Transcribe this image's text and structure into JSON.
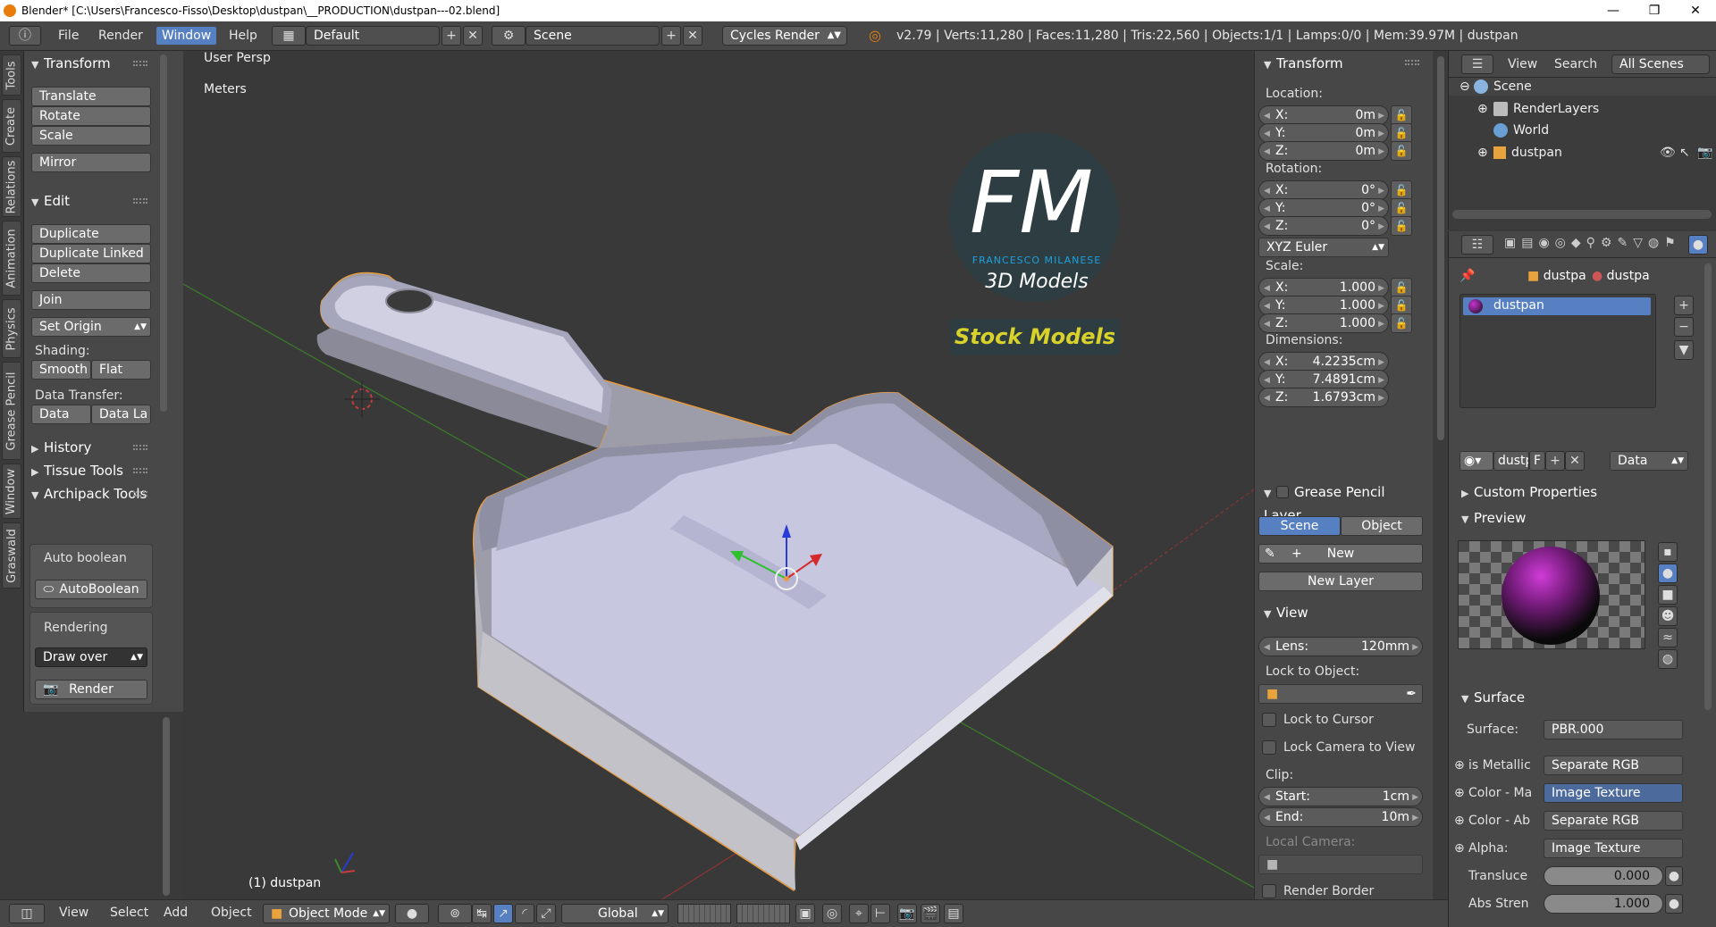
{
  "window": {
    "title": "Blender* [C:\\Users\\Francesco-Fisso\\Desktop\\dustpan\\__PRODUCTION\\dustpan---02.blend]",
    "minimize": "—",
    "maximize": "❐",
    "close": "✕"
  },
  "topbar": {
    "menus": [
      "File",
      "Render",
      "Window",
      "Help"
    ],
    "active_menu": "Window",
    "screen_layout": "Default",
    "scene": "Scene",
    "engine": "Cycles Render",
    "stats": "v2.79 | Verts:11,280 | Faces:11,280 | Tris:22,560 | Objects:1/1 | Lamps:0/0 | Mem:39.97M | dustpan"
  },
  "tool_tabs": [
    "Tools",
    "Create",
    "Relations",
    "Animation",
    "Physics",
    "Grease Pencil",
    "Window",
    "Graswald"
  ],
  "toolshelf": {
    "transform": {
      "title": "Transform",
      "buttons": [
        "Translate",
        "Rotate",
        "Scale",
        "Mirror"
      ]
    },
    "edit": {
      "title": "Edit",
      "buttons": [
        "Duplicate",
        "Duplicate Linked",
        "Delete",
        "Join"
      ],
      "set_origin": "Set Origin",
      "shading_label": "Shading:",
      "smooth": "Smooth",
      "flat": "Flat",
      "data_transfer_label": "Data Transfer:",
      "data": "Data",
      "data_la": "Data La"
    },
    "history": "History",
    "tissue": "Tissue Tools",
    "archipack": "Archipack Tools",
    "auto_boolean_label": "Auto boolean",
    "auto_boolean_btn": "AutoBoolean",
    "rendering_label": "Rendering",
    "draw_over": "Draw over",
    "render_btn": "Render"
  },
  "viewport": {
    "view_name": "User Persp",
    "units": "Meters",
    "object_label": "(1) dustpan",
    "watermark": {
      "letters": "FM",
      "name": "FRANCESCO MILANESE",
      "sub": "3D Models",
      "banner": "Stock Models"
    }
  },
  "npanel": {
    "transform_title": "Transform",
    "location_label": "Location:",
    "location": [
      {
        "k": "X:",
        "v": "0m"
      },
      {
        "k": "Y:",
        "v": "0m"
      },
      {
        "k": "Z:",
        "v": "0m"
      }
    ],
    "rotation_label": "Rotation:",
    "rotation": [
      {
        "k": "X:",
        "v": "0°"
      },
      {
        "k": "Y:",
        "v": "0°"
      },
      {
        "k": "Z:",
        "v": "0°"
      }
    ],
    "rotation_mode": "XYZ Euler",
    "scale_label": "Scale:",
    "scale": [
      {
        "k": "X:",
        "v": "1.000"
      },
      {
        "k": "Y:",
        "v": "1.000"
      },
      {
        "k": "Z:",
        "v": "1.000"
      }
    ],
    "dimensions_label": "Dimensions:",
    "dimensions": [
      {
        "k": "X:",
        "v": "4.2235cm"
      },
      {
        "k": "Y:",
        "v": "7.4891cm"
      },
      {
        "k": "Z:",
        "v": "1.6793cm"
      }
    ],
    "gp_title": "Grease Pencil Layer",
    "gp_scene": "Scene",
    "gp_object": "Object",
    "gp_new": "New",
    "gp_new_layer": "New Layer",
    "view_title": "View",
    "lens_k": "Lens:",
    "lens_v": "120mm",
    "lock_to_object": "Lock to Object:",
    "lock_to_cursor": "Lock to Cursor",
    "lock_camera": "Lock Camera to View",
    "clip_label": "Clip:",
    "clip_start_k": "Start:",
    "clip_start_v": "1cm",
    "clip_end_k": "End:",
    "clip_end_v": "10m",
    "local_camera": "Local Camera:",
    "render_border": "Render Border"
  },
  "outliner": {
    "view": "View",
    "search": "Search",
    "all_scenes": "All Scenes",
    "items": [
      "Scene",
      "RenderLayers",
      "World",
      "dustpan"
    ]
  },
  "properties": {
    "breadcrumb": [
      "dustpa",
      "dustpa"
    ],
    "material_slot": "dustpan",
    "mat_name": "dustp",
    "mat_f": "F",
    "mat_link": "Data",
    "custom_props": "Custom Properties",
    "preview": "Preview",
    "surface_title": "Surface",
    "rows": [
      {
        "k": "Surface:",
        "v": "PBR.000"
      },
      {
        "k": "is Metallic",
        "v": "Separate RGB"
      },
      {
        "k": "Color - Ma",
        "v": "Image Texture"
      },
      {
        "k": "Color - Ab",
        "v": "Separate RGB"
      },
      {
        "k": "Alpha:",
        "v": "Image Texture"
      },
      {
        "k": "Transluce",
        "v": "0.000"
      },
      {
        "k": "Abs Stren",
        "v": "1.000"
      }
    ]
  },
  "bottombar": {
    "menus": [
      "View",
      "Select",
      "Add",
      "Object"
    ],
    "mode": "Object Mode",
    "orientation": "Global"
  },
  "colors": {
    "accent": "#5680c2",
    "x_axis": "#c83c3c",
    "y_axis": "#3c8c2a",
    "selection": "#e89b3c",
    "logo_blue": "#1ea0dc",
    "banner_yellow": "#d9d22a"
  }
}
